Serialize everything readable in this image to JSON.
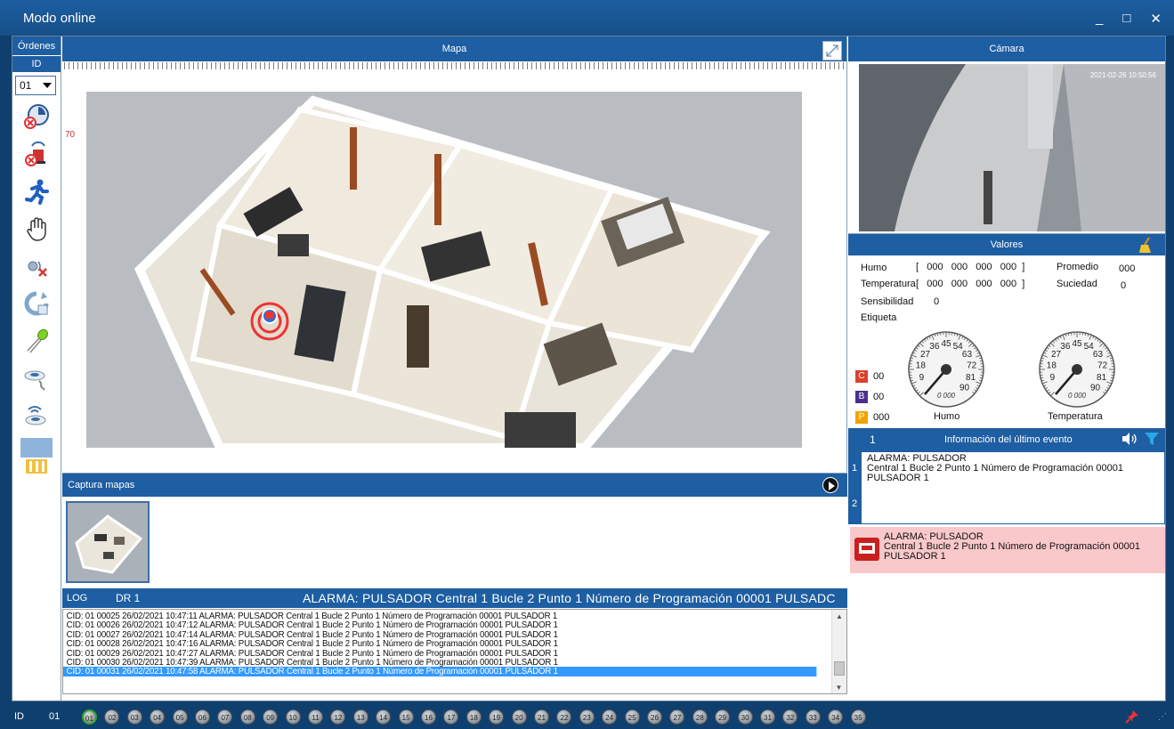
{
  "window": {
    "title": "Modo online",
    "controls": [
      "_",
      "□",
      "✕"
    ]
  },
  "leftbar": {
    "header": "Órdenes",
    "id_label": "ID",
    "id_value": "01"
  },
  "map": {
    "title": "Mapa",
    "marker_label": "70"
  },
  "capture": {
    "title": "Captura mapas"
  },
  "log": {
    "label": "LOG",
    "current_id": "DR 1",
    "ticker": "ALARMA: PULSADOR Central 1 Bucle 2 Punto 1 Número de Programación 00001 PULSADC",
    "lines": [
      "CID: 01 00025 26/02/2021 10:47:11 ALARMA: PULSADOR Central 1 Bucle 2 Punto 1 Número de Programación 00001 PULSADOR 1",
      "CID: 01 00026 26/02/2021 10:47:12 ALARMA: PULSADOR Central 1 Bucle 2 Punto 1 Número de Programación 00001 PULSADOR 1",
      "CID: 01 00027 26/02/2021 10:47:14 ALARMA: PULSADOR Central 1 Bucle 2 Punto 1 Número de Programación 00001 PULSADOR 1",
      "CID: 01 00028 26/02/2021 10:47:16 ALARMA: PULSADOR Central 1 Bucle 2 Punto 1 Número de Programación 00001 PULSADOR 1",
      "CID: 01 00029 26/02/2021 10:47:27 ALARMA: PULSADOR Central 1 Bucle 2 Punto 1 Número de Programación 00001 PULSADOR 1",
      "CID: 01 00030 26/02/2021 10:47:39 ALARMA: PULSADOR Central 1 Bucle 2 Punto 1 Número de Programación 00001 PULSADOR 1",
      "CID: 01 00031 26/02/2021 10:47:58 ALARMA: PULSADOR Central 1 Bucle 2 Punto 1 Número de Programación 00001 PULSADOR 1"
    ]
  },
  "camera": {
    "title": "Cámara",
    "timestamp": "2021-02-26 10:50:56"
  },
  "valores": {
    "title": "Valores",
    "humo_label": "Humo",
    "humo_values": "[   000   000   000   000  ]",
    "promedio_label": "Promedio",
    "promedio_value": "000",
    "temp_label": "Temperatura",
    "temp_values": "[   000   000   000   000  ]",
    "suciedad_label": "Suciedad",
    "suciedad_value": "0",
    "sensibilidad_label": "Sensibilidad",
    "sensibilidad_value": "0",
    "etiqueta_label": "Etiqueta",
    "badges": [
      {
        "letter": "C",
        "value": "00",
        "color": "#d9412c"
      },
      {
        "letter": "B",
        "value": "00",
        "color": "#4b2f8f"
      },
      {
        "letter": "P",
        "value": "000",
        "color": "#f0a400"
      }
    ],
    "gauge_humo_label": "Humo",
    "gauge_temp_label": "Temperatura",
    "gauge_ticks": [
      "9",
      "18",
      "27",
      "36",
      "45",
      "54",
      "63",
      "72",
      "81",
      "90"
    ],
    "gauge_center": "0 000"
  },
  "event": {
    "count": "1",
    "title": "Información del último evento",
    "side_numbers": [
      "1",
      "2"
    ],
    "line1": "ALARMA: PULSADOR",
    "line2": "Central 1 Bucle 2 Punto 1 Número de Programación 00001",
    "line3": "PULSADOR 1"
  },
  "alarm": {
    "line1": "ALARMA: PULSADOR",
    "line2": "Central 1 Bucle 2 Punto 1 Número de Programación 00001",
    "line3": "PULSADOR 1"
  },
  "bottombar": {
    "id_label": "ID",
    "id_value": "01",
    "nodes": [
      "01",
      "02",
      "03",
      "04",
      "05",
      "06",
      "07",
      "08",
      "09",
      "10",
      "11",
      "12",
      "13",
      "14",
      "15",
      "16",
      "17",
      "18",
      "19",
      "20",
      "21",
      "22",
      "23",
      "24",
      "25",
      "26",
      "27",
      "28",
      "29",
      "30",
      "31",
      "32",
      "33",
      "34",
      "35"
    ],
    "active_node": "01"
  },
  "colors": {
    "header_blue": "#1e5ea2",
    "frame_blue": "#0f3f6e",
    "alarm_pink": "#f9c8cb",
    "log_select": "#3399ff"
  }
}
